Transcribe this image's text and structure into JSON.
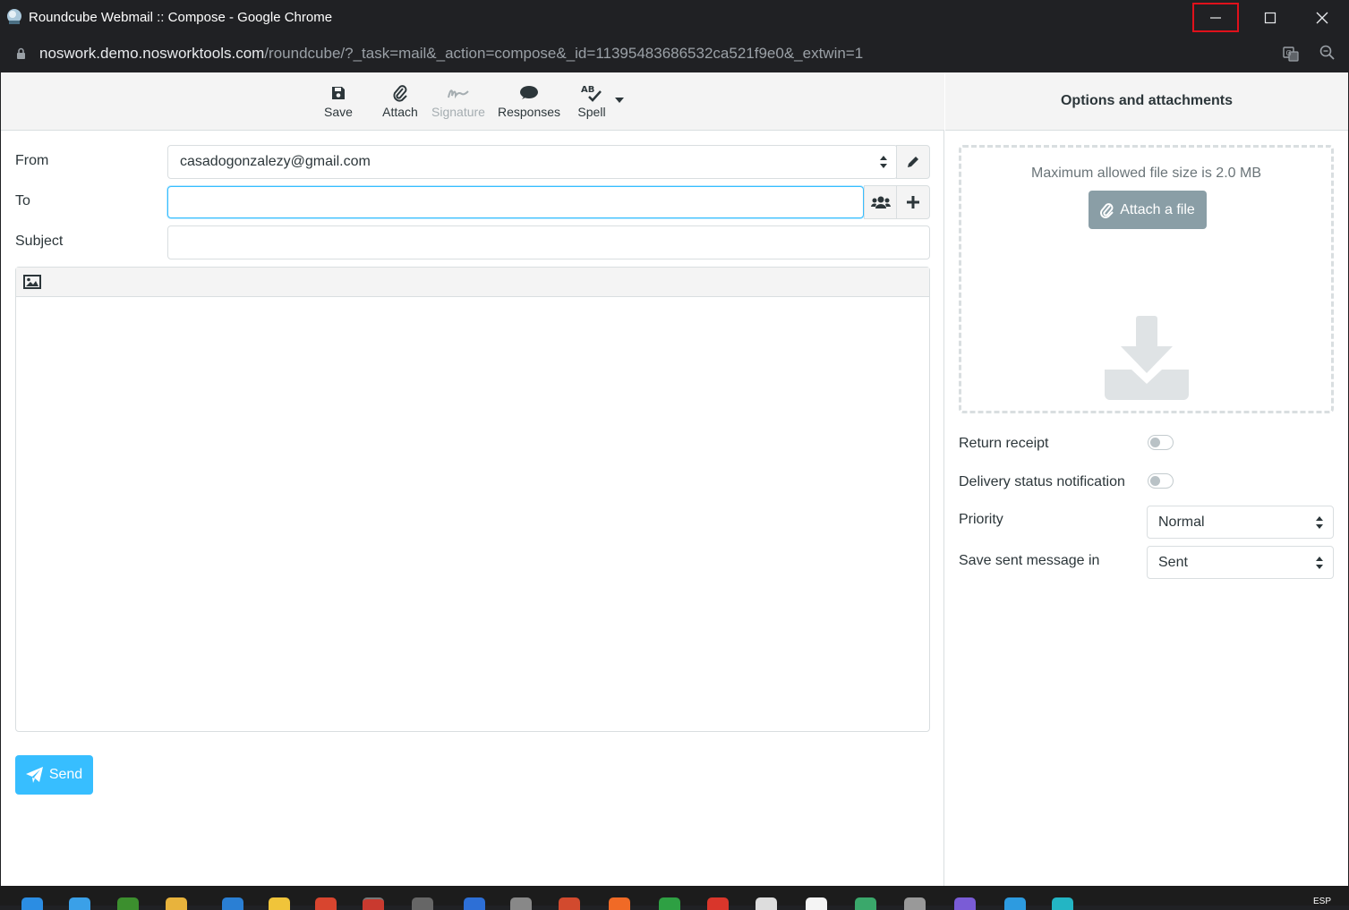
{
  "window": {
    "title": "Roundcube Webmail :: Compose - Google Chrome"
  },
  "address_bar": {
    "host": "noswork.demo.nosworktools.com",
    "path": "/roundcube/?_task=mail&_action=compose&_id=11395483686532ca521f9e0&_extwin=1"
  },
  "toolbar": {
    "save_label": "Save",
    "attach_label": "Attach",
    "signature_label": "Signature",
    "responses_label": "Responses",
    "spell_label": "Spell"
  },
  "compose": {
    "from_label": "From",
    "from_value": "casadogonzalezy@gmail.com",
    "to_label": "To",
    "to_value": "",
    "subject_label": "Subject",
    "subject_value": "",
    "send_label": "Send"
  },
  "options": {
    "header": "Options and attachments",
    "max_size_text": "Maximum allowed file size is 2.0 MB",
    "attach_file_label": "Attach a file",
    "return_receipt_label": "Return receipt",
    "return_receipt_on": false,
    "dsn_label": "Delivery status notification",
    "dsn_on": false,
    "priority_label": "Priority",
    "priority_value": "Normal",
    "save_sent_label": "Save sent message in",
    "save_sent_value": "Sent"
  },
  "taskbar": {
    "language": "ESP"
  },
  "colors": {
    "accent": "#37beff",
    "titlebar": "#202124",
    "highlight": "#e0111b"
  }
}
